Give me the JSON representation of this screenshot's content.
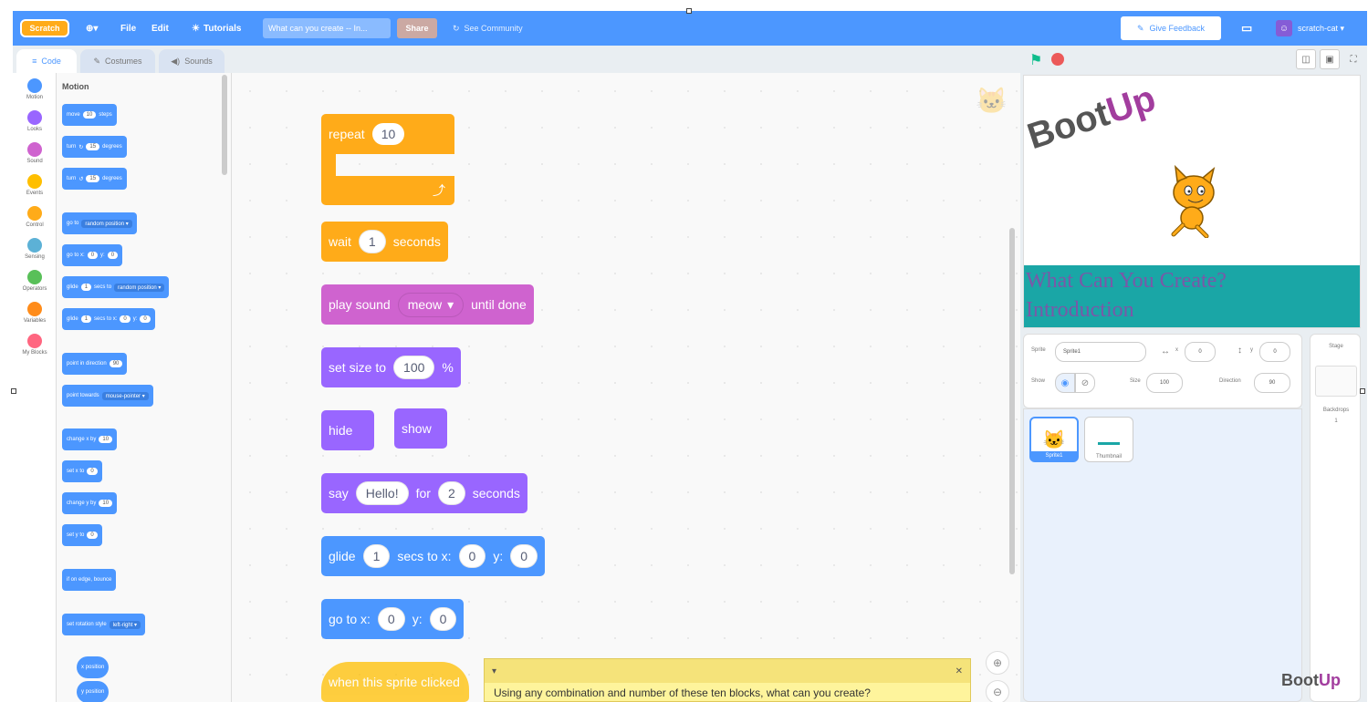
{
  "menubar": {
    "logo": "Scratch",
    "globe": "⊕▾",
    "file": "File",
    "edit": "Edit",
    "tutorials": "Tutorials",
    "project_title": "What can you create -- In...",
    "share": "Share",
    "see_community": "See Community",
    "give_feedback": "Give Feedback",
    "username": "scratch-cat ▾"
  },
  "tabs": {
    "code": "Code",
    "costumes": "Costumes",
    "sounds": "Sounds"
  },
  "categories": [
    {
      "label": "Motion",
      "color": "#4c97ff"
    },
    {
      "label": "Looks",
      "color": "#9966ff"
    },
    {
      "label": "Sound",
      "color": "#cf63cf"
    },
    {
      "label": "Events",
      "color": "#ffbf00"
    },
    {
      "label": "Control",
      "color": "#ffab19"
    },
    {
      "label": "Sensing",
      "color": "#5cb1d6"
    },
    {
      "label": "Operators",
      "color": "#59c059"
    },
    {
      "label": "Variables",
      "color": "#ff8c1a"
    },
    {
      "label": "My Blocks",
      "color": "#ff6680"
    }
  ],
  "palette": {
    "title": "Motion",
    "blocks": {
      "move": {
        "a": "move",
        "v": "10",
        "b": "steps"
      },
      "turn_cw": {
        "a": "turn",
        "v": "15",
        "b": "degrees"
      },
      "turn_ccw": {
        "a": "turn",
        "v": "15",
        "b": "degrees"
      },
      "go_to": {
        "a": "go to",
        "d": "random position ▾"
      },
      "go_to_xy": {
        "a": "go to x:",
        "x": "0",
        "b": "y:",
        "y": "0"
      },
      "glide_to": {
        "a": "glide",
        "v": "1",
        "b": "secs to",
        "d": "random position ▾"
      },
      "glide_xy": {
        "a": "glide",
        "v": "1",
        "b": "secs to x:",
        "x": "0",
        "c": "y:",
        "y": "0"
      },
      "point_dir": {
        "a": "point in direction",
        "v": "90"
      },
      "point_towards": {
        "a": "point towards",
        "d": "mouse-pointer ▾"
      },
      "change_x": {
        "a": "change x by",
        "v": "10"
      },
      "set_x": {
        "a": "set x to",
        "v": "0"
      },
      "change_y": {
        "a": "change y by",
        "v": "10"
      },
      "set_y": {
        "a": "set y to",
        "v": "0"
      },
      "bounce": {
        "a": "if on edge, bounce"
      },
      "rotation": {
        "a": "set rotation style",
        "d": "left-right ▾"
      },
      "x_pos": {
        "a": "x position"
      },
      "y_pos": {
        "a": "y position"
      }
    }
  },
  "script": {
    "repeat": {
      "label": "repeat",
      "value": "10",
      "arrow": "⤴"
    },
    "wait": {
      "a": "wait",
      "v": "1",
      "b": "seconds"
    },
    "play_sound": {
      "a": "play sound",
      "d": "meow",
      "caret": "▾",
      "b": "until done"
    },
    "set_size": {
      "a": "set size to",
      "v": "100",
      "b": "%"
    },
    "hide": "hide",
    "show": "show",
    "say": {
      "a": "say",
      "v": "Hello!",
      "b": "for",
      "v2": "2",
      "c": "seconds"
    },
    "glide": {
      "a": "glide",
      "v": "1",
      "b": "secs to x:",
      "x": "0",
      "c": "y:",
      "y": "0"
    },
    "go_to": {
      "a": "go to x:",
      "x": "0",
      "b": "y:",
      "y": "0"
    },
    "when_clicked": "when this sprite clicked"
  },
  "comment": {
    "caret": "▾",
    "close": "✕",
    "text": "Using any combination and number of these ten blocks, what can you create?"
  },
  "stage": {
    "logo_boot": "Boot",
    "logo_up": "Up",
    "banner_line1": "What Can You Create?",
    "banner_line2": "Introduction"
  },
  "sprite_info": {
    "sprite_label": "Sprite",
    "sprite_name": "Sprite1",
    "x_arrow": "↔",
    "x_label": "x",
    "x_value": "0",
    "y_arrow": "↕",
    "y_label": "y",
    "y_value": "0",
    "show_label": "Show",
    "size_label": "Size",
    "size_value": "100",
    "direction_label": "Direction",
    "direction_value": "90"
  },
  "sprites": [
    {
      "name": "Sprite1",
      "selected": true
    },
    {
      "name": "Thumbnail",
      "selected": false
    }
  ],
  "stage_pane": {
    "title": "Stage",
    "backdrops_label": "Backdrops",
    "backdrops_count": "1"
  },
  "corner_logo": {
    "boot": "Boot",
    "up": "Up"
  }
}
